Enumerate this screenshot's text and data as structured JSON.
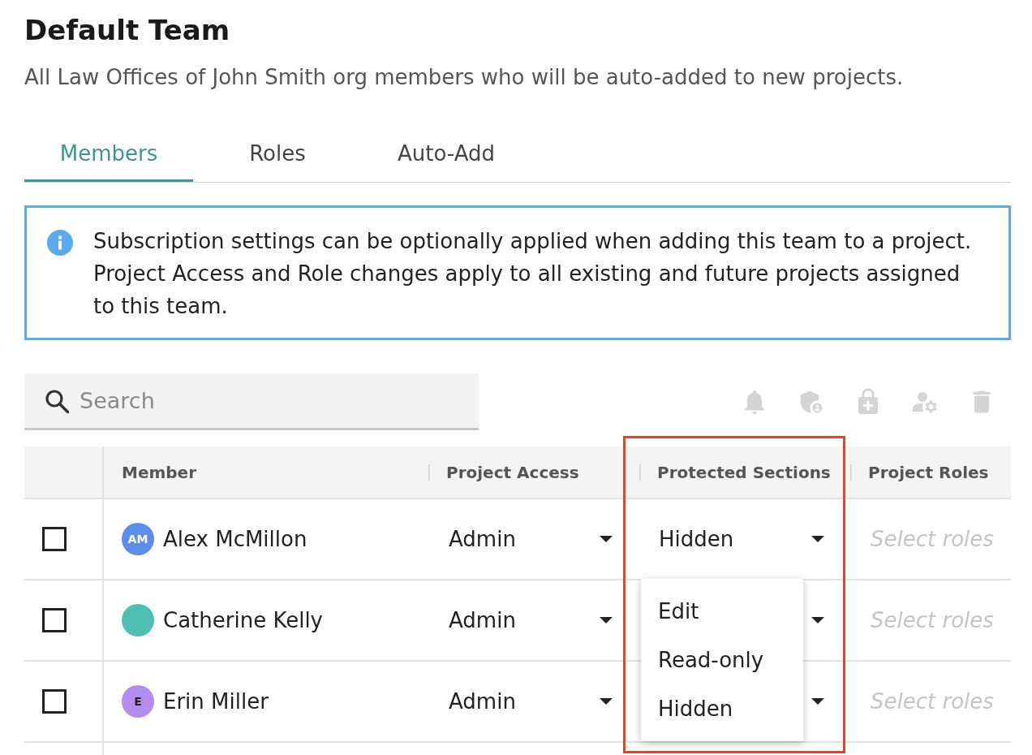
{
  "page": {
    "title": "Default Team",
    "subtitle": "All Law Offices of John Smith org members who will be auto-added to new projects."
  },
  "tabs": [
    {
      "label": "Members",
      "selected": true
    },
    {
      "label": "Roles",
      "selected": false
    },
    {
      "label": "Auto-Add",
      "selected": false
    }
  ],
  "info_banner": {
    "text": "Subscription settings can be optionally applied when adding this team to a project. Project Access and Role changes apply to all existing and future projects assigned to this team."
  },
  "search": {
    "placeholder": "Search"
  },
  "toolbar": [
    {
      "kind": "notifications",
      "disabled": true
    },
    {
      "kind": "admin",
      "disabled": true
    },
    {
      "kind": "lock_add",
      "disabled": true
    },
    {
      "kind": "manage_account",
      "disabled": true
    },
    {
      "kind": "delete",
      "disabled": true
    }
  ],
  "table": {
    "columns": [
      "Member",
      "Project Access",
      "Protected Sections",
      "Project Roles"
    ],
    "rows": [
      {
        "checked": false,
        "avatar": {
          "kind": "initials",
          "initials": "AM",
          "color": "#5b8def"
        },
        "name": "Alex McMillon",
        "project_access": "Admin",
        "protected_sections": {
          "value": "Hidden",
          "expanded": true,
          "options": [
            "Edit",
            "Read-only",
            "Hidden"
          ]
        },
        "roles_placeholder": "Select roles"
      },
      {
        "checked": false,
        "avatar": {
          "kind": "photo"
        },
        "name": "Catherine Kelly",
        "project_access": "Admin",
        "protected_sections": {
          "expanded": false
        },
        "roles_placeholder": "Select roles"
      },
      {
        "checked": false,
        "avatar": {
          "kind": "initials",
          "initials": "E",
          "color": "#b48cf0"
        },
        "name": "Erin Miller",
        "project_access": "Admin",
        "protected_sections": {
          "expanded": false
        },
        "roles_placeholder": "Select roles"
      }
    ]
  }
}
